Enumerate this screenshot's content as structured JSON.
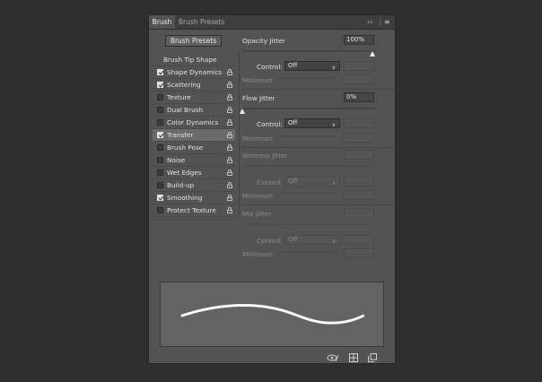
{
  "tabs": [
    {
      "label": "Brush",
      "active": true
    },
    {
      "label": "Brush Presets",
      "active": false
    }
  ],
  "toolbar_icons": {
    "expand": "double-chevron-right-icon",
    "menu": "hamburger-menu-icon"
  },
  "brush_presets_button": "Brush Presets",
  "brush_tip_shape": "Brush Tip Shape",
  "options": [
    {
      "label": "Shape Dynamics",
      "checked": true
    },
    {
      "label": "Scattering",
      "checked": true
    },
    {
      "label": "Texture",
      "checked": false
    },
    {
      "label": "Dual Brush",
      "checked": false
    },
    {
      "label": "Color Dynamics",
      "checked": false
    },
    {
      "label": "Transfer",
      "checked": true,
      "selected": true
    },
    {
      "label": "Brush Pose",
      "checked": false
    },
    {
      "label": "Noise",
      "checked": false
    },
    {
      "label": "Wet Edges",
      "checked": false
    },
    {
      "label": "Build-up",
      "checked": false
    },
    {
      "label": "Smoothing",
      "checked": true
    },
    {
      "label": "Protect Texture",
      "checked": false
    }
  ],
  "opacity_jitter": {
    "label": "Opacity Jitter",
    "value": "100%",
    "slider": 1.0,
    "control_label": "Control:",
    "control_value": "Off",
    "minimum_label": "Minimum"
  },
  "flow_jitter": {
    "label": "Flow Jitter",
    "value": "0%",
    "slider": 0.0,
    "control_label": "Control:",
    "control_value": "Off",
    "minimum_label": "Minimum"
  },
  "wetness_jitter": {
    "label": "Wetness Jitter",
    "control_label": "Control:",
    "control_value": "Off",
    "minimum_label": "Minimum"
  },
  "mix_jitter": {
    "label": "Mix Jitter",
    "control_label": "Control:",
    "control_value": "Off",
    "minimum_label": "Minimum"
  },
  "bottom_icons": [
    "toggle-eye-icon",
    "grid-icon",
    "new-preset-icon"
  ]
}
